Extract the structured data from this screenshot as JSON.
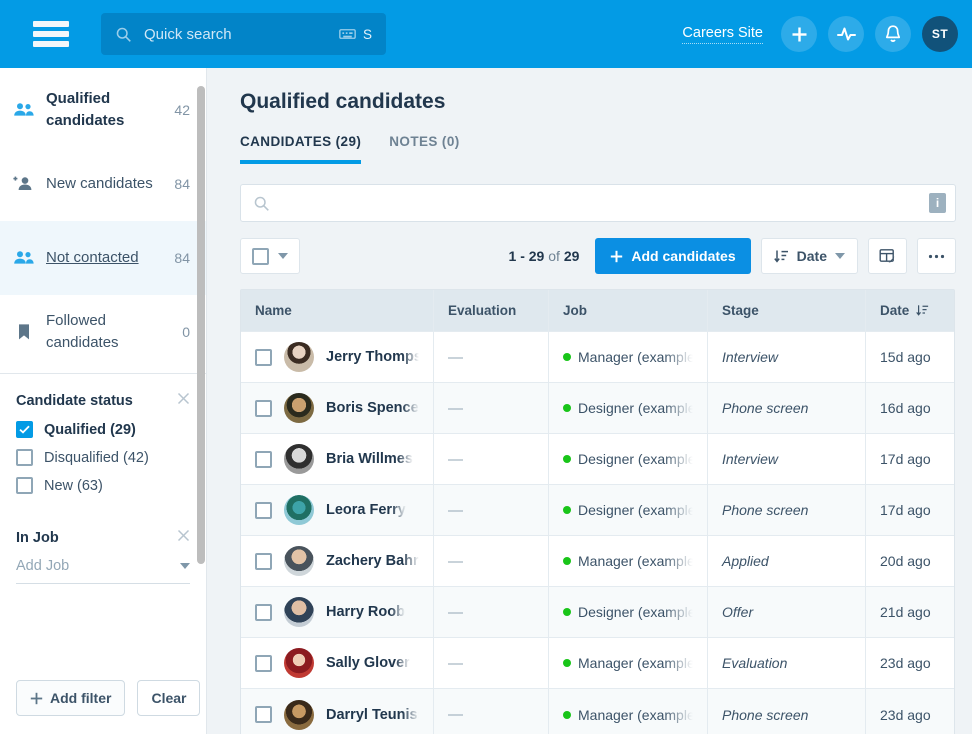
{
  "header": {
    "menu_icon": "hamburger-icon",
    "search": {
      "placeholder": "Quick search",
      "shortcut_key": "S",
      "icon": "search-icon",
      "kbd_icon": "keyboard-icon"
    },
    "careers_link": "Careers Site",
    "add_icon": "plus-icon",
    "activity_icon": "pulse-icon",
    "notifications_icon": "bell-icon",
    "avatar_initials": "ST"
  },
  "sidebar": {
    "items": [
      {
        "label": "Qualified candidates",
        "count": "42",
        "icon": "people-icon"
      },
      {
        "label": "New candidates",
        "count": "84",
        "icon": "person-add-icon"
      },
      {
        "label": "Not contacted",
        "count": "84",
        "icon": "people-icon"
      },
      {
        "label": "Followed candidates",
        "count": "0",
        "icon": "bookmark-icon"
      }
    ],
    "filters": [
      {
        "title": "Candidate status",
        "close_icon": "close-icon",
        "options": [
          {
            "label": "Qualified (29)",
            "checked": true
          },
          {
            "label": "Disqualified (42)",
            "checked": false
          },
          {
            "label": "New (63)",
            "checked": false
          }
        ]
      },
      {
        "title": "In Job",
        "close_icon": "close-icon",
        "select_placeholder": "Add Job"
      }
    ],
    "add_filter_label": "Add filter",
    "clear_label": "Clear"
  },
  "main": {
    "title": "Qualified candidates",
    "tabs": [
      {
        "label": "CANDIDATES (29)",
        "active": true
      },
      {
        "label": "NOTES (0)",
        "active": false
      }
    ],
    "search": {
      "value": "",
      "placeholder": "",
      "icon": "search-icon",
      "info_badge": "i"
    },
    "toolbar": {
      "select_all_icon": "checkbox-icon",
      "select_caret_icon": "chevron-down-icon",
      "pager_range": "1 - 29",
      "pager_of": "of",
      "pager_total": "29",
      "add_candidates_label": "Add candidates",
      "sort_label": "Date",
      "sort_icon": "sort-descending-icon",
      "columns_icon": "table-edit-icon",
      "more_icon": "ellipsis-icon"
    },
    "table": {
      "columns": [
        "Name",
        "Evaluation",
        "Job",
        "Stage",
        "Date"
      ],
      "sorted_column": "Date",
      "sort_icon": "sort-descending-icon",
      "rows": [
        {
          "name": "Jerry Thompson",
          "evaluation": "—",
          "job": "Manager (example)",
          "stage": "Interview",
          "date": "15d ago"
        },
        {
          "name": "Boris Spencer",
          "evaluation": "—",
          "job": "Designer (example)",
          "stage": "Phone screen",
          "date": "16d ago"
        },
        {
          "name": "Bria Willmes",
          "evaluation": "—",
          "job": "Designer (example)",
          "stage": "Interview",
          "date": "17d ago"
        },
        {
          "name": "Leora Ferry",
          "evaluation": "—",
          "job": "Designer (example)",
          "stage": "Phone screen",
          "date": "17d ago"
        },
        {
          "name": "Zachery Bahringer",
          "evaluation": "—",
          "job": "Manager (example)",
          "stage": "Applied",
          "date": "20d ago"
        },
        {
          "name": "Harry Roob",
          "evaluation": "—",
          "job": "Designer (example)",
          "stage": "Offer",
          "date": "21d ago"
        },
        {
          "name": "Sally Glover",
          "evaluation": "—",
          "job": "Manager (example)",
          "stage": "Evaluation",
          "date": "23d ago"
        },
        {
          "name": "Darryl Teunissen",
          "evaluation": "—",
          "job": "Manager (example)",
          "stage": "Phone screen",
          "date": "23d ago"
        }
      ]
    }
  },
  "colors": {
    "brand_blue": "#039be5",
    "primary_button": "#0b8fe3",
    "page_bg": "#eff3f6",
    "job_dot_green": "#19c519",
    "avatar_bg": "#11527a"
  }
}
